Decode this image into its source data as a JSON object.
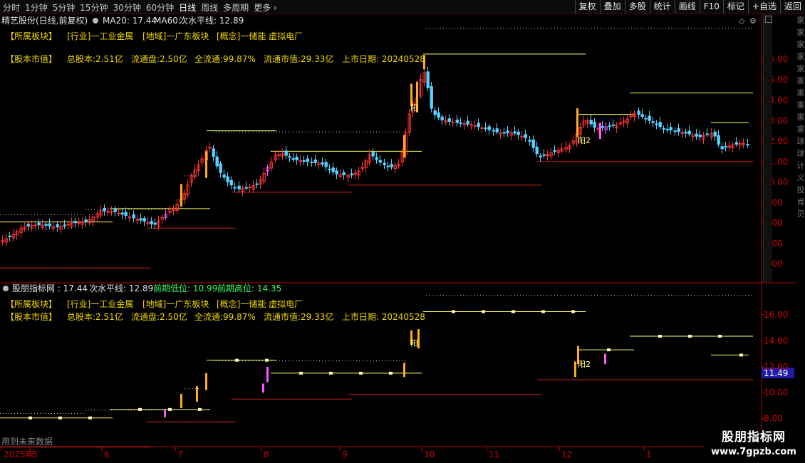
{
  "toolbar": {
    "periods": [
      "分时",
      "1分钟",
      "5分钟",
      "15分钟",
      "30分钟",
      "60分钟",
      "日线",
      "周线",
      "多周期",
      "更多 ›"
    ],
    "active_period": "日线",
    "buttons": [
      "复权",
      "叠加",
      "多股",
      "统计",
      "画线",
      "F10",
      "标记",
      "+自选",
      "返回"
    ]
  },
  "top_panel": {
    "stock_title": "精艺股份(日线,前复权)",
    "ma20": "MA20: 17.44",
    "ma60": "MA60:",
    "level_label": "次水平线: 12.89",
    "info_row1": [
      "【所属板块】",
      "[行业]一工业金属",
      "[地域]一广东板块",
      "[概念]一储能 虚拟电厂"
    ],
    "info_row2": [
      "【股本市值】",
      "总股本:2.51亿",
      "流通盘:2.50亿",
      "全流通:99.87%",
      "流通市值:29.33亿",
      "上市日期: 20240528"
    ],
    "price_axis": [
      "16.00",
      "15.00",
      "14.00",
      "13.00",
      "12.00",
      "11.00",
      "10.00",
      "9.00",
      "8.00",
      "7.00",
      "6.00"
    ],
    "markers": [
      "阳",
      "阳2"
    ]
  },
  "bottom_panel": {
    "indicator_title": "股朋指标网 : 17.44",
    "level_label": "次水平线: 12.89",
    "prev_low": "前期低位: 10.99",
    "prev_high": "前期高位: 14.35",
    "info_row1": [
      "【所属板块】",
      "[行业]一工业金属",
      "[地域]一广东板块",
      "[概念]一储能 虚拟电厂"
    ],
    "info_row2": [
      "【股本市值】",
      "总股本:2.51亿",
      "流通盘:2.50亿",
      "全流通:99.87%",
      "流通市值:29.33亿",
      "上市日期: 20240528"
    ],
    "price_axis": [
      "16.00",
      "14.00",
      "12.00",
      "10.00",
      "8.00"
    ],
    "current_price": "11.49",
    "markers": [
      "阳",
      "阳2"
    ],
    "footnote": "用到未来数据"
  },
  "date_axis": [
    "2025年",
    "5",
    "6",
    "7",
    "8",
    "9",
    "10",
    "11",
    "12",
    "1"
  ],
  "side_text": [
    "家",
    "家",
    "家",
    "家",
    "家",
    "家",
    "家",
    "家",
    "家",
    "家",
    "球",
    "球",
    "计",
    "义",
    "投",
    "肖",
    "贝"
  ],
  "watermark": {
    "line1": "股朋指标网",
    "line2": "www.7gpzb.com"
  },
  "colors": {
    "up": "#ff3333",
    "down": "#54d2ff",
    "doji": "#ff55ff",
    "signal": "#ffaa22",
    "level": "#ffff66",
    "support": "#cc2222",
    "axis": "#cc0000",
    "cyan_text": "#00e0ff"
  }
}
